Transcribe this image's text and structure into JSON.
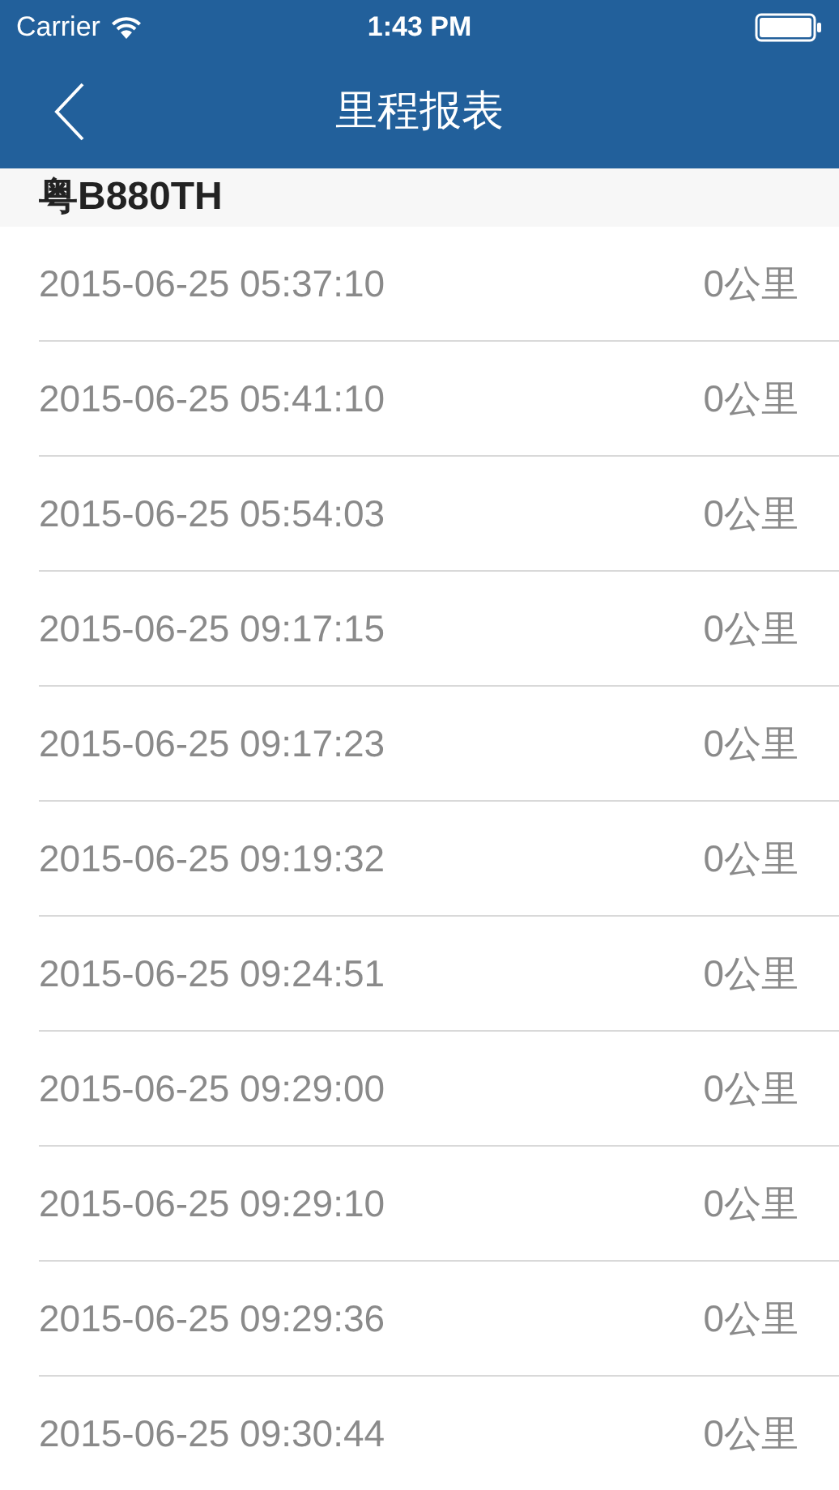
{
  "status_bar": {
    "carrier": "Carrier",
    "time": "1:43 PM"
  },
  "nav_bar": {
    "title": "里程报表"
  },
  "section": {
    "title": "粤B880TH"
  },
  "rows": [
    {
      "time": "2015-06-25 05:37:10",
      "distance": "0公里"
    },
    {
      "time": "2015-06-25 05:41:10",
      "distance": "0公里"
    },
    {
      "time": "2015-06-25 05:54:03",
      "distance": "0公里"
    },
    {
      "time": "2015-06-25 09:17:15",
      "distance": "0公里"
    },
    {
      "time": "2015-06-25 09:17:23",
      "distance": "0公里"
    },
    {
      "time": "2015-06-25 09:19:32",
      "distance": "0公里"
    },
    {
      "time": "2015-06-25 09:24:51",
      "distance": "0公里"
    },
    {
      "time": "2015-06-25 09:29:00",
      "distance": "0公里"
    },
    {
      "time": "2015-06-25 09:29:10",
      "distance": "0公里"
    },
    {
      "time": "2015-06-25 09:29:36",
      "distance": "0公里"
    },
    {
      "time": "2015-06-25 09:30:44",
      "distance": "0公里"
    }
  ]
}
